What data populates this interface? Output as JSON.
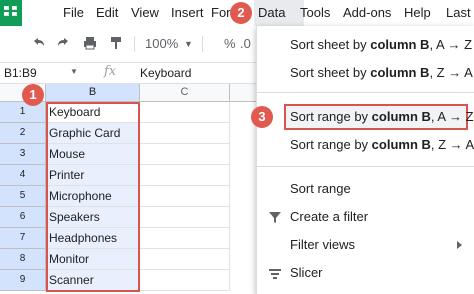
{
  "menubar": {
    "items": [
      "File",
      "Edit",
      "View",
      "Insert",
      "Form",
      "Data",
      "Tools",
      "Add-ons",
      "Help",
      "Last"
    ],
    "active": "Data"
  },
  "toolbar": {
    "zoom": "100%",
    "percent": "%",
    "decimal": ".0"
  },
  "formula_bar": {
    "range": "B1:B9",
    "fx": "fx",
    "value": "Keyboard"
  },
  "grid": {
    "columns": [
      "B",
      "C"
    ],
    "rows": [
      "1",
      "2",
      "3",
      "4",
      "5",
      "6",
      "7",
      "8",
      "9"
    ],
    "cells_b": [
      "Keyboard",
      "Graphic Card",
      "Mouse",
      "Printer",
      "Microphone",
      "Speakers",
      "Headphones",
      "Monitor",
      "Scanner"
    ]
  },
  "dropdown": {
    "sort_sheet_az": {
      "prefix": "Sort sheet by ",
      "bold": "column B",
      "suffix": ", A → Z"
    },
    "sort_sheet_za": {
      "prefix": "Sort sheet by ",
      "bold": "column B",
      "suffix": ", Z → A"
    },
    "sort_range_az": {
      "prefix": "Sort range by ",
      "bold": "column B",
      "suffix": ", A → Z"
    },
    "sort_range_za": {
      "prefix": "Sort range by ",
      "bold": "column B",
      "suffix": ", Z → A"
    },
    "sort_range": "Sort range",
    "create_filter": "Create a filter",
    "filter_views": "Filter views",
    "slicer": "Slicer"
  },
  "callouts": {
    "one": "1",
    "two": "2",
    "three": "3"
  },
  "colors": {
    "accent_red": "#e05a4f",
    "selection_blue": "#e8f0fe",
    "sheets_green": "#0f9d58"
  }
}
